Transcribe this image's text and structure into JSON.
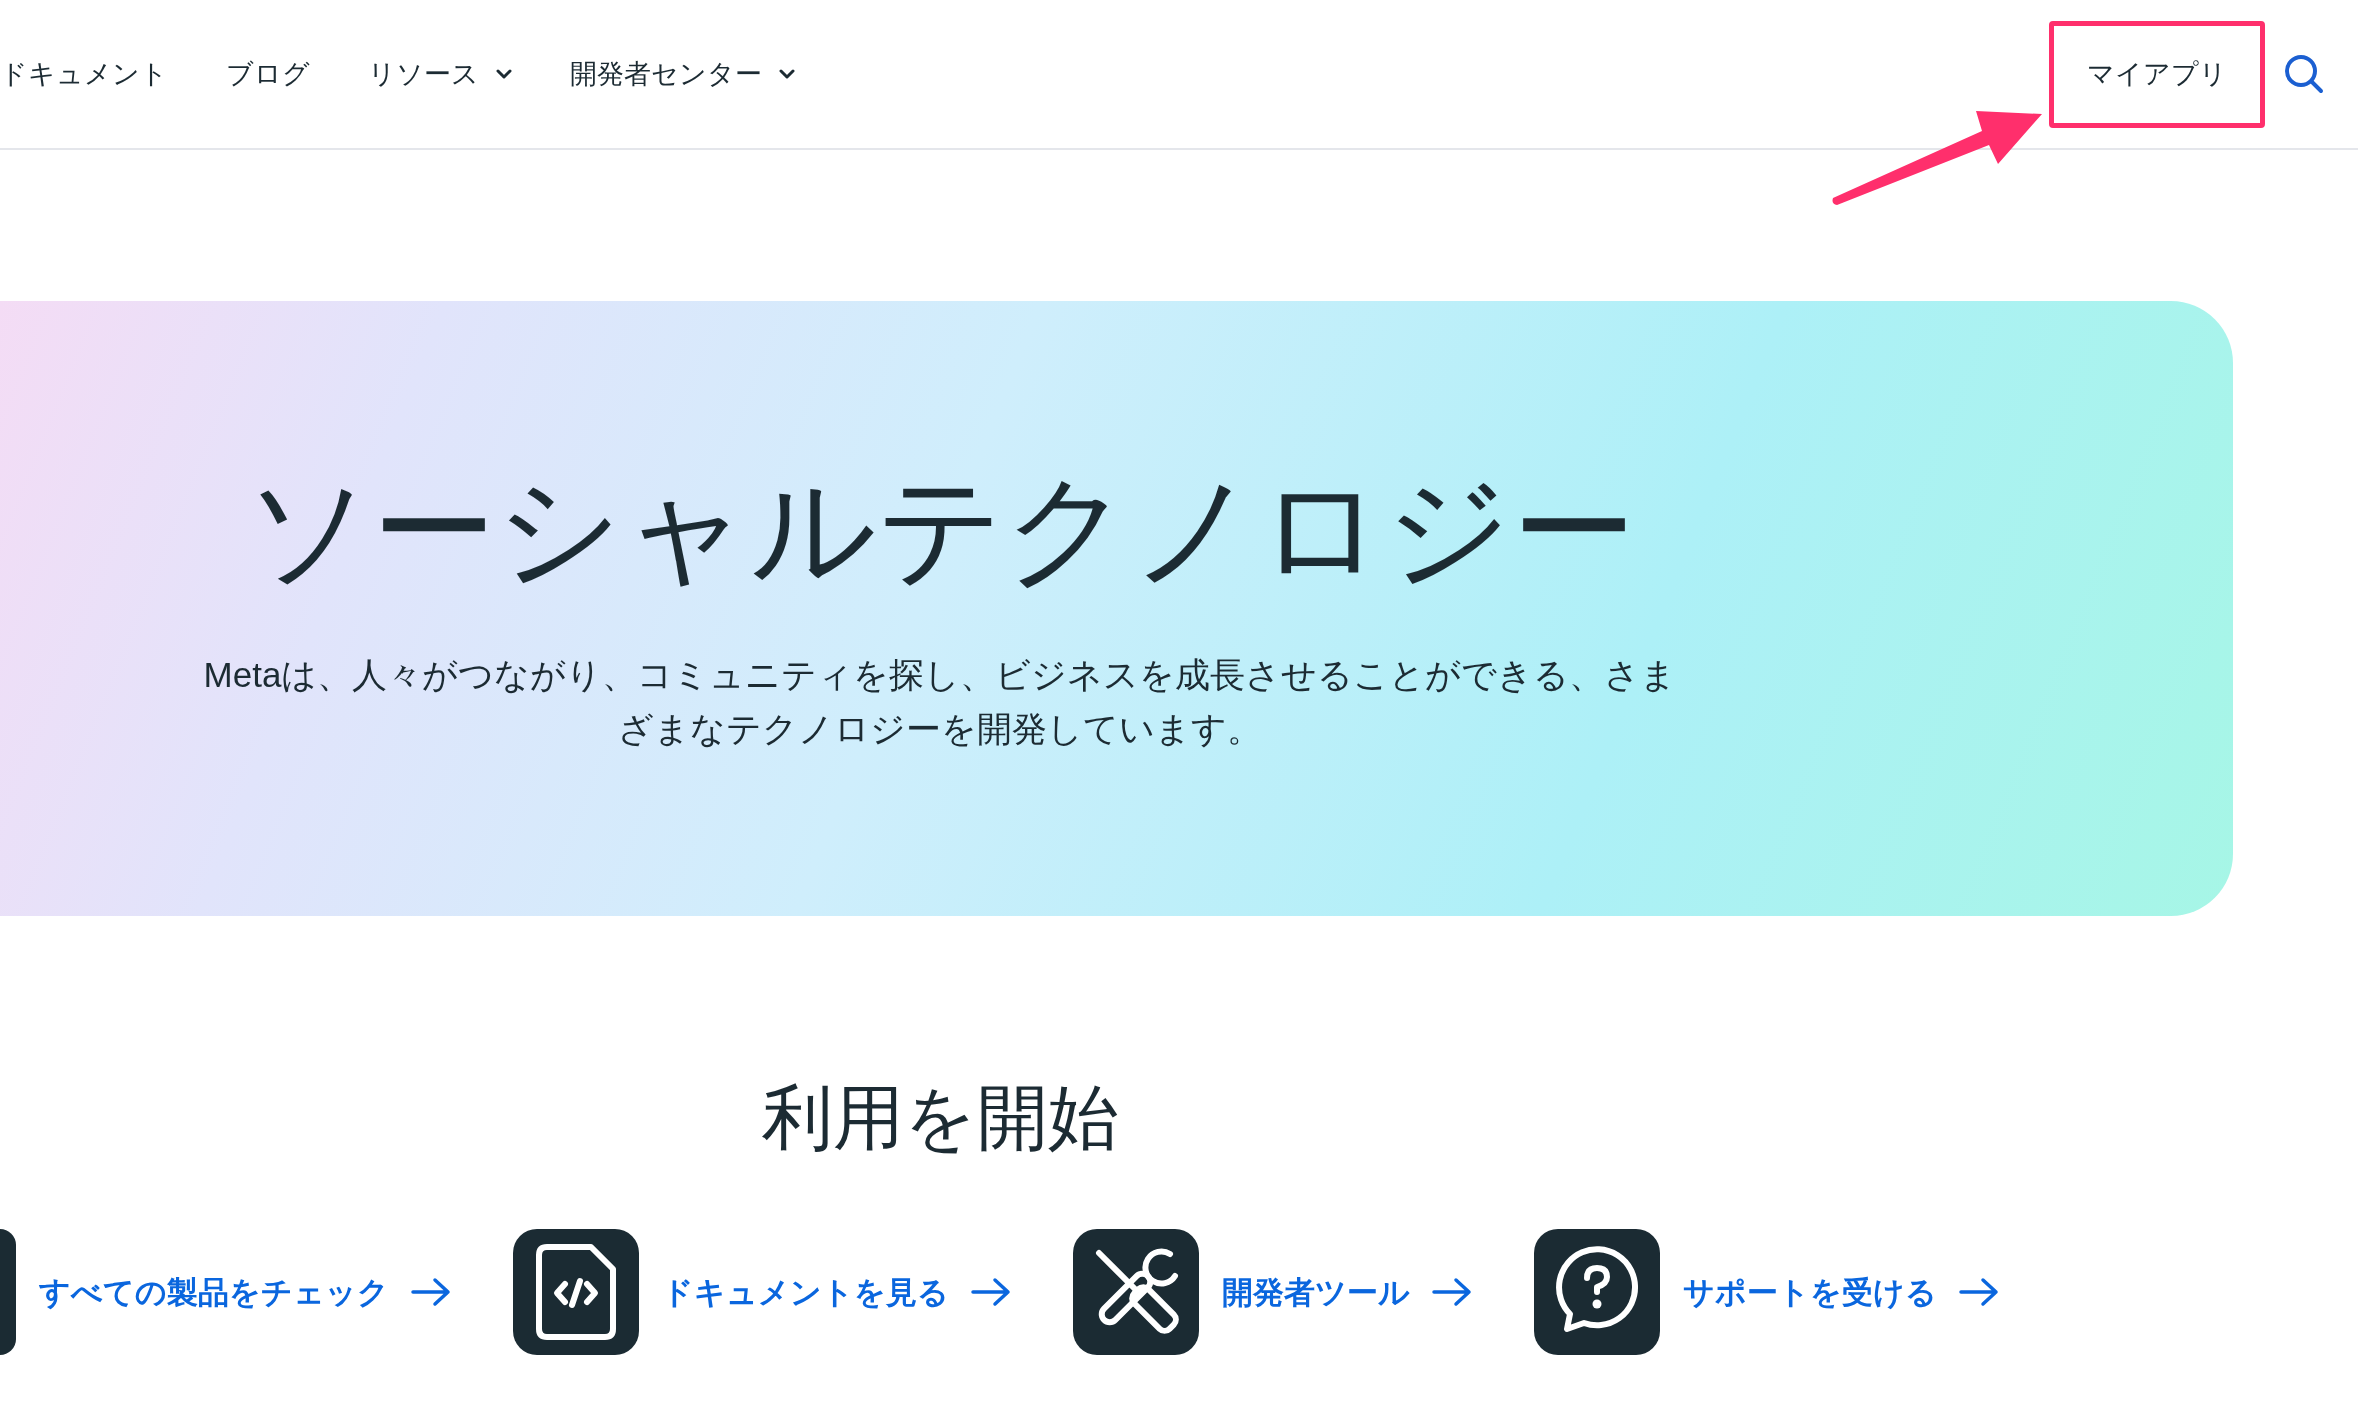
{
  "nav": {
    "items": [
      {
        "label": "ドキュメント",
        "has_menu": false
      },
      {
        "label": "ブログ",
        "has_menu": false
      },
      {
        "label": "リソース",
        "has_menu": true
      },
      {
        "label": "開発者センター",
        "has_menu": true
      }
    ],
    "my_apps": {
      "label": "マイアプリ",
      "highlighted": true
    }
  },
  "hero": {
    "title": "ソーシャルテクノロジー",
    "description": "Metaは、人々がつながり、コミュニティを探し、ビジネスを成長させることができる、さまざまなテクノロジーを開発しています。"
  },
  "get_started": {
    "heading": "利用を開始",
    "links": [
      {
        "label": "すべての製品をチェック",
        "kind": "products"
      },
      {
        "label": "ドキュメントを見る",
        "kind": "docs"
      },
      {
        "label": "開発者ツール",
        "kind": "tools"
      },
      {
        "label": "サポートを受ける",
        "kind": "support"
      }
    ]
  }
}
